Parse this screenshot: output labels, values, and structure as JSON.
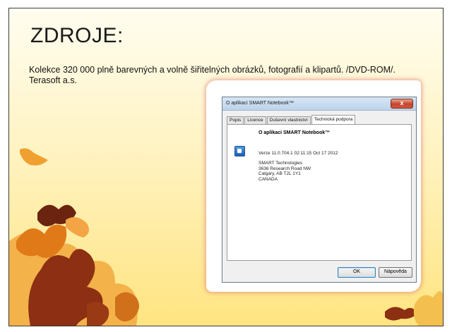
{
  "slide": {
    "title": "ZDROJE:",
    "body": "Kolekce 320 000 plně barevných a volně šiřitelných obrázků, fotografií a klipartů. /DVD-ROM/. Terasoft a.s."
  },
  "dialog": {
    "title": "O aplikaci SMART Notebook™",
    "close_symbol": "x",
    "tabs": [
      "Popis",
      "Licence",
      "Duševní vlastnictví",
      "Technická podpora"
    ],
    "active_tab": "Technická podpora",
    "heading": "O aplikaci SMART Notebook™",
    "version": "Verze 11.0.704.1 02:11:15 Oct 17 2012",
    "address": [
      "SMART Technologies",
      "3636 Research Road NW",
      "Calgary, AB T2L 1Y1",
      "CANADA"
    ],
    "ok_label": "OK",
    "help_label": "Nápověda"
  },
  "colors": {
    "leaf_dark": "#7a2a12",
    "leaf_orange": "#e8891e",
    "leaf_light": "#f6c35a",
    "close_red": "#c7432a"
  }
}
